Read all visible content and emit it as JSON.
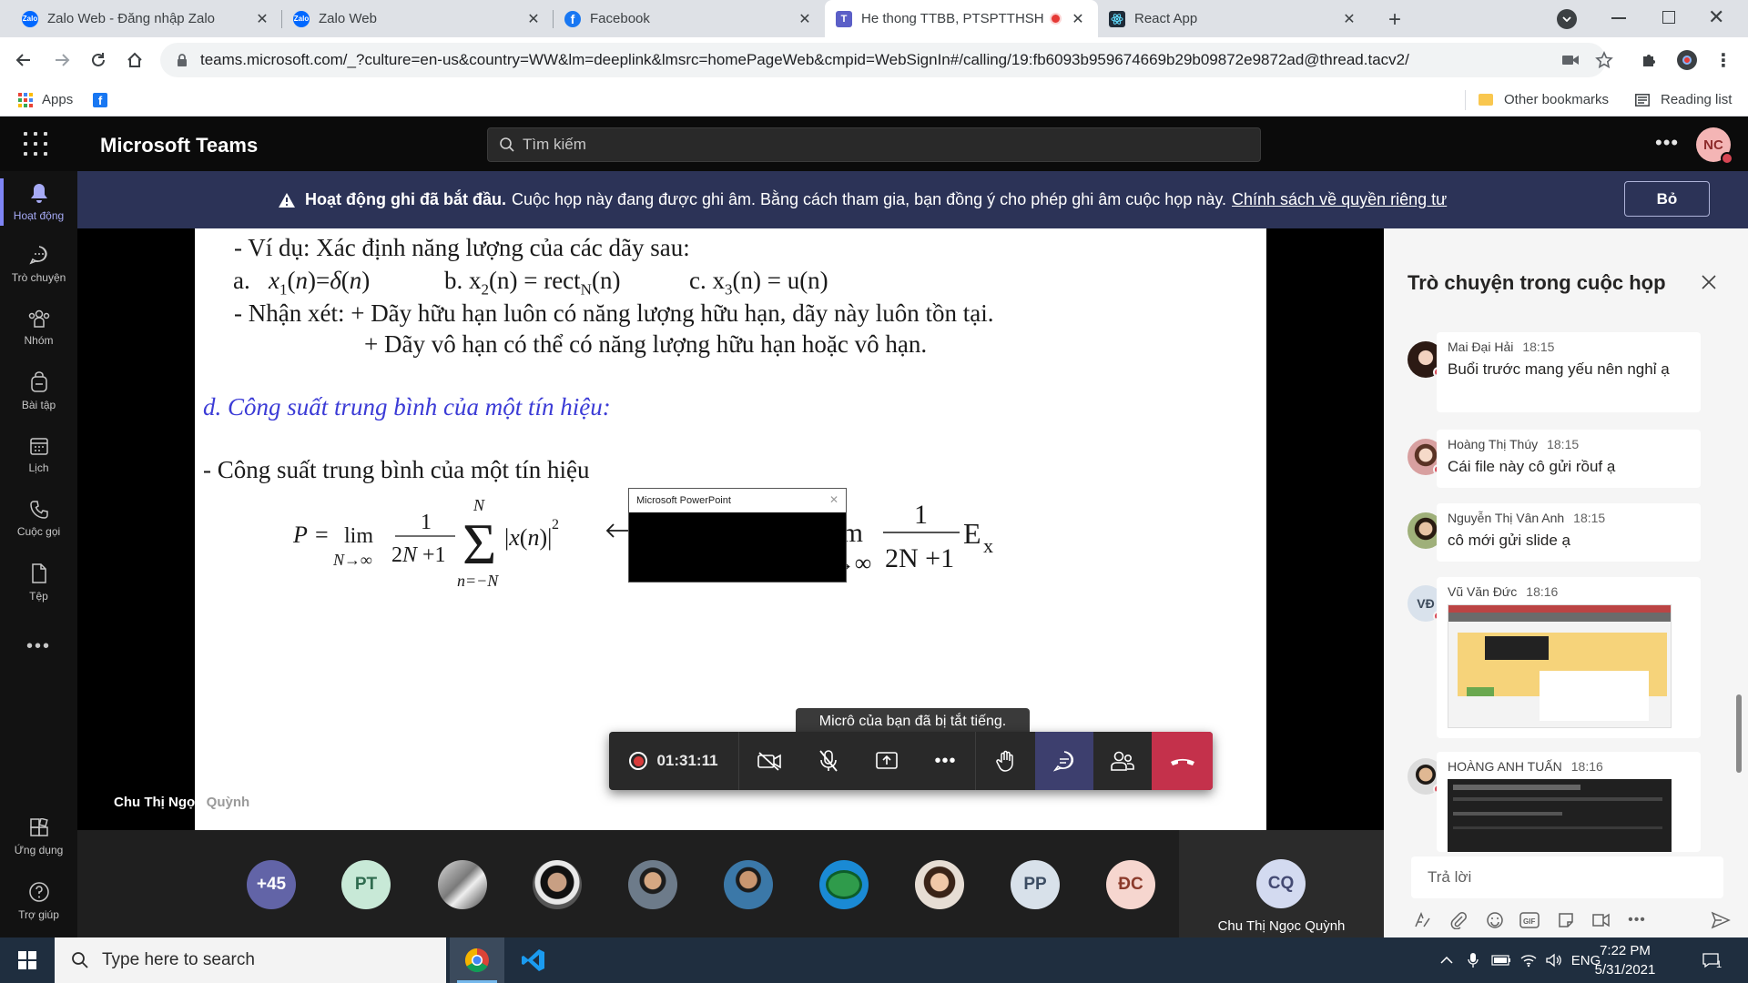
{
  "browser": {
    "tabs": [
      {
        "title": "Zalo Web - Đăng nhập Zalo",
        "favicon": "zalo-icon"
      },
      {
        "title": "Zalo Web",
        "favicon": "zalo-icon"
      },
      {
        "title": "Facebook",
        "favicon": "facebook-icon"
      },
      {
        "title": "He thong TTBB, PTSPTTHSH",
        "favicon": "teams-icon",
        "recording": true,
        "active": true
      },
      {
        "title": "React App",
        "favicon": "react-icon"
      }
    ],
    "url": "teams.microsoft.com/_?culture=en-us&country=WW&lm=deeplink&lmsrc=homePageWeb&cmpid=WebSignIn#/calling/19:fb6093b959674669b29b09872e9872ad@thread.tacv2/",
    "bookmarks": {
      "apps": "Apps",
      "other": "Other bookmarks",
      "reading_list": "Reading list"
    }
  },
  "teams": {
    "brand": "Microsoft Teams",
    "search_placeholder": "Tìm kiếm",
    "user_initials": "NC",
    "rail": [
      {
        "label": "Hoạt động",
        "icon": "bell-icon",
        "active": true
      },
      {
        "label": "Trò chuyện",
        "icon": "chat-icon"
      },
      {
        "label": "Nhóm",
        "icon": "teams-group-icon"
      },
      {
        "label": "Bài tập",
        "icon": "backpack-icon"
      },
      {
        "label": "Lịch",
        "icon": "calendar-icon"
      },
      {
        "label": "Cuộc gọi",
        "icon": "phone-icon"
      },
      {
        "label": "Tệp",
        "icon": "file-icon"
      },
      {
        "label": "Ứng dụng",
        "icon": "apps-icon"
      },
      {
        "label": "Trợ giúp",
        "icon": "help-icon"
      }
    ],
    "banner": {
      "title": "Hoạt động ghi đã bắt đầu.",
      "message": "Cuộc họp này đang được ghi âm. Bằng cách tham gia, bạn đồng ý cho phép ghi âm cuộc họp này.",
      "link": "Chính sách về quyền riêng tư",
      "dismiss": "Bỏ"
    }
  },
  "slide": {
    "line1": "- Ví dụ: Xác định năng lượng của các dãy sau:",
    "ex_a": "a.",
    "ex_b": "b. x",
    "ex_b2": "(n) = rect",
    "ex_b3": "(n)",
    "ex_c": "c. x",
    "ex_c2": "(n) = u(n)",
    "remark1": "- Nhận xét: +  Dãy hữu hạn luôn có năng lượng hữu hạn, dãy này luôn tồn tại.",
    "remark2": "+ Dãy vô hạn có thể có năng lượng hữu hạn hoặc vô hạn.",
    "heading_d": "d. Công suất trung bình của một tín hiệu:",
    "power_text": "- Công suất trung bình của một tín hiệu",
    "popup_title": "Microsoft PowerPoint"
  },
  "presenter": {
    "name": "Chu Thị Ngọc",
    "name_faded": "Quỳnh"
  },
  "call": {
    "timer": "01:31:11",
    "mute_tooltip": "Micrô của bạn đã bị tắt tiếng."
  },
  "participants": {
    "overflow": "+45",
    "initials": [
      "PT",
      "PP",
      "ĐC"
    ],
    "self_initials": "CQ",
    "self_name": "Chu Thị Ngọc Quỳnh"
  },
  "chat": {
    "title": "Trò chuyện trong cuộc họp",
    "messages": [
      {
        "author": "Mai Đại Hải",
        "time": "18:15",
        "text": "Buổi trước mang yếu nên nghỉ ạ"
      },
      {
        "author": "Hoàng Thị Thúy",
        "time": "18:15",
        "text": "Cái file này cô gửi rồuf ạ"
      },
      {
        "author": "Nguyễn Thị Vân Anh",
        "time": "18:15",
        "text": "cô mới gửi slide ạ"
      },
      {
        "author": "Vũ Văn Đức",
        "time": "18:16",
        "initials": "VĐ"
      },
      {
        "author": "HOÀNG ANH TUẤN",
        "time": "18:16"
      }
    ],
    "reply_placeholder": "Trả lời"
  },
  "taskbar": {
    "search": "Type here to search",
    "lang": "ENG",
    "time": "7:22 PM",
    "date": "5/31/2021",
    "notifications": "1"
  },
  "colors": {
    "teams_accent": "#7f85f5",
    "banner_bg": "#2c3357",
    "hangup": "#c4314b",
    "slide_heading": "#3b3bd6"
  }
}
